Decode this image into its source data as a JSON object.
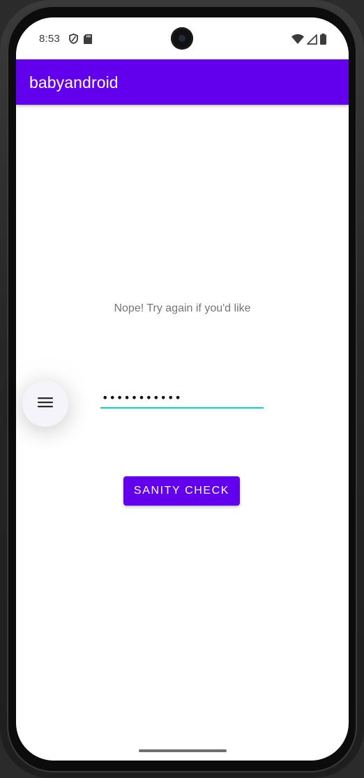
{
  "status_bar": {
    "time": "8:53",
    "left_icons": [
      "shield-icon",
      "sd-card-icon"
    ],
    "right_icons": [
      "wifi-icon",
      "cell-signal-icon",
      "battery-icon"
    ]
  },
  "app_bar": {
    "title": "babyandroid"
  },
  "main": {
    "message": "Nope! Try again if you'd like",
    "password_value": "ccccccccccc",
    "button_label": "SANITY CHECK"
  },
  "floating_menu": {
    "icon": "menu-icon"
  },
  "colors": {
    "primary": "#6200ee",
    "accent": "#03dac5",
    "message_text": "#757575"
  }
}
